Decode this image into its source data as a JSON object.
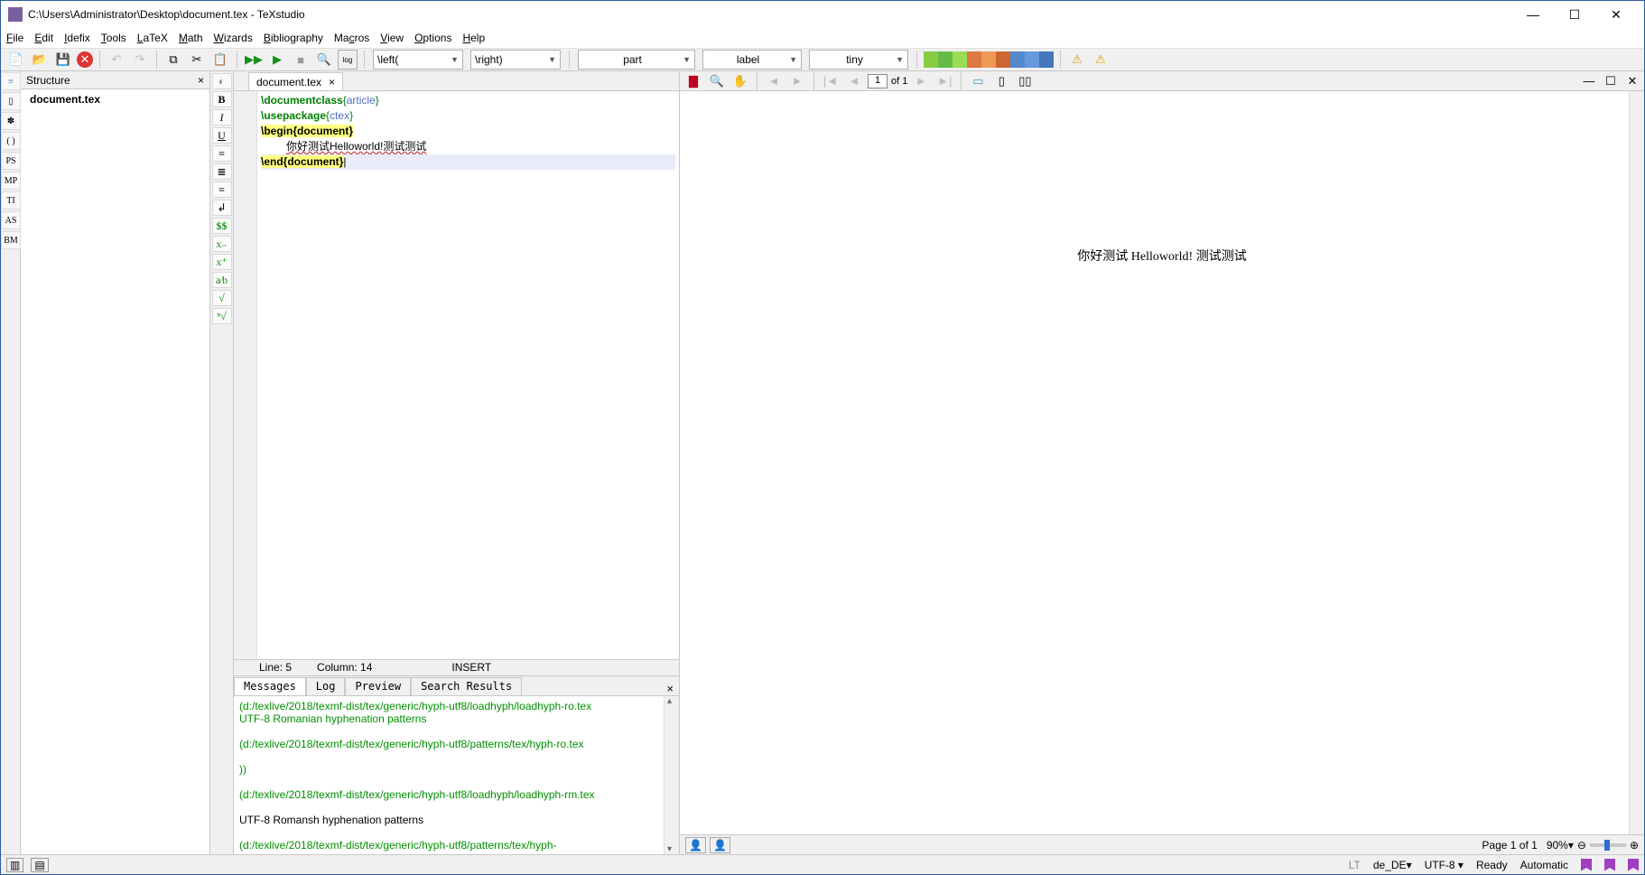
{
  "window": {
    "title": "C:\\Users\\Administrator\\Desktop\\document.tex - TeXstudio"
  },
  "menu": [
    "File",
    "Edit",
    "Idefix",
    "Tools",
    "LaTeX",
    "Math",
    "Wizards",
    "Bibliography",
    "Macros",
    "View",
    "Options",
    "Help"
  ],
  "dropdowns": {
    "left": "\\left(",
    "right": "\\right)",
    "part": "part",
    "label": "label",
    "tiny": "tiny"
  },
  "structure": {
    "title": "Structure",
    "file": "document.tex"
  },
  "tab": {
    "name": "document.tex"
  },
  "code": {
    "l1a": "\\documentclass",
    "l1b": "{",
    "l1c": "article",
    "l1d": "}",
    "l2a": "\\usepackage",
    "l2b": "{",
    "l2c": "ctex",
    "l2d": "}",
    "l3a": "\\begin",
    "l3b": "{",
    "l3c": "document",
    "l3d": "}",
    "l4": "你好测试Helloworld!测试测试",
    "l5a": "\\end",
    "l5b": "{",
    "l5c": "document",
    "l5d": "}",
    "l5cursor": "|"
  },
  "editorStatus": {
    "line": "Line: 5",
    "col": "Column: 14",
    "mode": "INSERT"
  },
  "msgtabs": {
    "messages": "Messages",
    "log": "Log",
    "preview": "Preview",
    "search": "Search Results"
  },
  "log": {
    "l1": "(d:/texlive/2018/texmf-dist/tex/generic/hyph-utf8/loadhyph/loadhyph-ro.tex",
    "l2": "UTF-8 Romanian hyphenation patterns",
    "l3": "(d:/texlive/2018/texmf-dist/tex/generic/hyph-utf8/patterns/tex/hyph-ro.tex",
    "l4": "))",
    "l5": "(d:/texlive/2018/texmf-dist/tex/generic/hyph-utf8/loadhyph/loadhyph-rm.tex",
    "l6": "UTF-8 Romansh hyphenation patterns",
    "l7": "(d:/texlive/2018/texmf-dist/tex/generic/hyph-utf8/patterns/tex/hyph-"
  },
  "pv": {
    "page": "1",
    "of": "of 1",
    "rendered": "你好测试 Helloworld! 测试测试",
    "pageinfo": "Page 1 of 1",
    "zoom": "90%"
  },
  "status": {
    "lt": "LT",
    "lang": "de_DE",
    "enc": "UTF-8",
    "ready": "Ready",
    "auto": "Automatic"
  },
  "sidebtns": {
    "b": "B",
    "i": "I",
    "u": "U",
    "ss": "$$"
  },
  "leftlabels": {
    "pS": "PS",
    "mp": "MP",
    "ti": "TI",
    "aS": "AS",
    "bm": "BM"
  }
}
